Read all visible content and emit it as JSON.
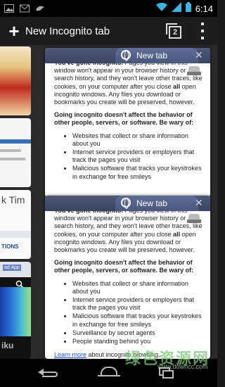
{
  "status_bar": {
    "time": "6:14",
    "left_icons": [
      "image-icon",
      "gmail-icon",
      "bird-icon"
    ],
    "right_icons": [
      "wifi-icon",
      "cell-signal-icon",
      "battery-icon"
    ]
  },
  "action_bar": {
    "new_tab_label": "New Incognito tab",
    "tab_count": "2",
    "icons": [
      "plus-icon",
      "tab-switcher-icon",
      "overflow-menu-icon"
    ]
  },
  "left_tabs": {
    "tab3_title_fragment": "k Tim",
    "tab3_options_fragment": "TIONS",
    "tab4_tag": "ad App",
    "tab4_footer_fragment": "iku"
  },
  "cards": [
    {
      "title": "New tab",
      "p1_prefix": "You've gone incognito.",
      "p1_rest": " Pages you view in this window won't appear in your browser history or search history, and they won't leave other traces, like cookies, on your computer after you close ",
      "p1_all": "all",
      "p1_end": " open incognito windows. Any files you download or bookmarks you create will be preserved, however.",
      "p2": "Going incognito doesn't affect the behavior of other people, servers, or software. Be wary of:",
      "bullets": [
        "Websites that collect or share information about you",
        "Internet service providers or employers that track the pages you visit",
        "Malicious software that tracks your keystrokes in exchange for free smileys"
      ]
    },
    {
      "title": "New tab",
      "p1_prefix": "You've gone incognito.",
      "p1_rest": " Pages you view in this window won't appear in your browser history or search history, and they won't leave other traces, like cookies, on your computer after you close ",
      "p1_all": "all",
      "p1_end": " open incognito windows. Any files you download or bookmarks you create will be preserved, however.",
      "p2": "Going incognito doesn't affect the behavior of other people, servers, or software. Be wary of:",
      "bullets": [
        "Websites that collect or share information about you",
        "Internet service providers or employers that track the pages you visit",
        "Malicious software that tracks your keystrokes in exchange for free smileys",
        "Surveillance by secret agents",
        "People standing behind you"
      ],
      "learn_more_link": "Learn more",
      "learn_more_rest": " about incognito browsing."
    }
  ],
  "nav_bar": {
    "icons": [
      "back-icon",
      "home-icon",
      "recent-apps-icon"
    ]
  },
  "watermark": {
    "text": "绿色资源网",
    "url": "www.downcc.com"
  },
  "colors": {
    "card_header": "#3a4563",
    "tab_pill": "#4a5880",
    "link": "#1a4fd0"
  }
}
